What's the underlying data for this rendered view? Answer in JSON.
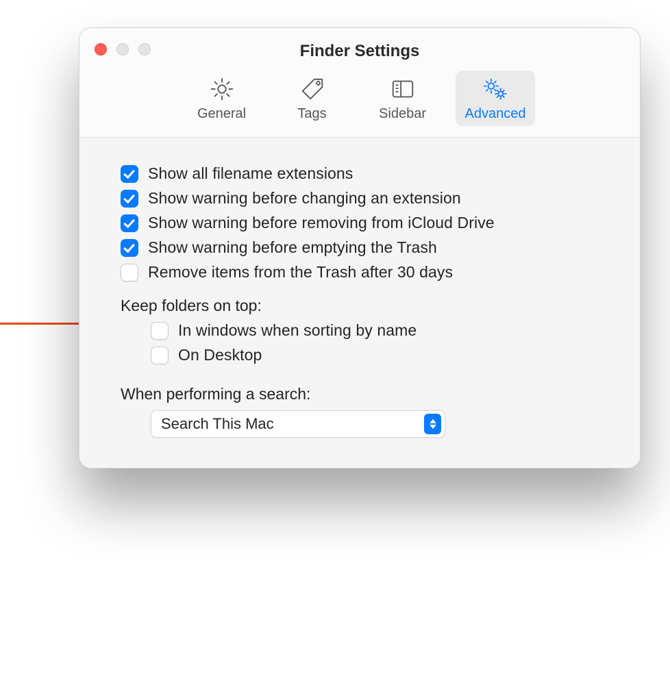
{
  "window": {
    "title": "Finder Settings"
  },
  "toolbar": {
    "items": [
      {
        "label": "General",
        "selected": false
      },
      {
        "label": "Tags",
        "selected": false
      },
      {
        "label": "Sidebar",
        "selected": false
      },
      {
        "label": "Advanced",
        "selected": true
      }
    ]
  },
  "options": {
    "show_all_extensions": {
      "label": "Show all filename extensions",
      "checked": true
    },
    "warn_change_extension": {
      "label": "Show warning before changing an extension",
      "checked": true
    },
    "warn_remove_icloud": {
      "label": "Show warning before removing from iCloud Drive",
      "checked": true
    },
    "warn_empty_trash": {
      "label": "Show warning before emptying the Trash",
      "checked": true
    },
    "remove_trash_30_days": {
      "label": "Remove items from the Trash after 30 days",
      "checked": false
    }
  },
  "keep_folders": {
    "heading": "Keep folders on top:",
    "in_windows": {
      "label": "In windows when sorting by name",
      "checked": false
    },
    "on_desktop": {
      "label": "On Desktop",
      "checked": false
    }
  },
  "search": {
    "heading": "When performing a search:",
    "selected": "Search This Mac"
  }
}
